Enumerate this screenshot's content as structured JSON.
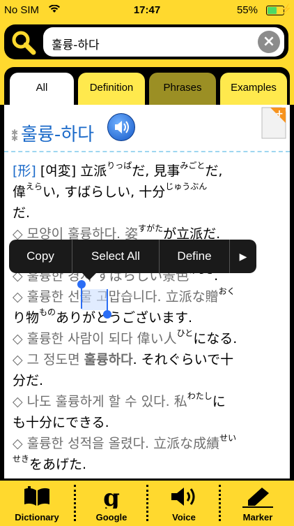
{
  "status": {
    "carrier": "No SIM",
    "time": "17:47",
    "battery_label": "55%",
    "battery_level": 0.55
  },
  "search": {
    "query": "훌륭-하다"
  },
  "tabs": [
    {
      "label": "All"
    },
    {
      "label": "Definition"
    },
    {
      "label": "Phrases"
    },
    {
      "label": "Examples"
    }
  ],
  "entry": {
    "headword": "훌륭-하다",
    "pos_tag": "[形]",
    "type_tag": "[여変]",
    "def1_a": "立派",
    "def1_ruby_a": "りっぱ",
    "def1_b": "だ, 見事",
    "def1_ruby_b": "みごと",
    "def1_c": "だ,",
    "def2_a": "偉",
    "def2_ruby_a": "えら",
    "def2_b": "い, すばらしい, 十分",
    "def2_ruby_b": "じゅうぶん",
    "def3": "だ.",
    "ex1_kr": "◇ 모양이 훌륭하다. 姿",
    "ex1_ruby": "すがた",
    "ex1_jp": "が立派だ.",
    "ex2_kr": "◇ 훌륭한 경치 すばらしい景色",
    "ex2_ruby": "けしき",
    "ex2_end": ".",
    "ex3_a": "◇ 훌륭한 ",
    "ex3_sel": "선물",
    "ex3_b": " 고맙습니다. 立派な贈",
    "ex3_ruby": "おく",
    "ex3_c": "り物",
    "ex3_ruby2": "もの",
    "ex3_d": "ありがとうございます.",
    "ex4_kr": "◇ 훌륭한 사람이 되다 偉い人",
    "ex4_ruby": "ひと",
    "ex4_jp": "になる.",
    "ex5_a": "◇ 그 정도면 ",
    "ex5_bold": "훌륭하다",
    "ex5_b": ". それぐらいで十",
    "ex5_c": "分だ.",
    "ex6_a": "◇ 나도 훌륭하게 할 수 있다. 私",
    "ex6_ruby": "わたし",
    "ex6_b": "に",
    "ex6_c": "も十分にできる.",
    "ex7_a": "◇ 훌륭한 성적을 올렸다. 立派な成績",
    "ex7_ruby": "せい",
    "ex7_ruby2": "せき",
    "ex7_b": "をあげた."
  },
  "context_menu": {
    "copy": "Copy",
    "select_all": "Select All",
    "define": "Define"
  },
  "toolbar": [
    {
      "label": "Dictionary",
      "icon": "book-icon"
    },
    {
      "label": "Google",
      "icon": "google-g-icon"
    },
    {
      "label": "Voice",
      "icon": "speaker-icon"
    },
    {
      "label": "Marker",
      "icon": "marker-icon"
    }
  ],
  "colors": {
    "accent_yellow": "#ffd92e",
    "olive_tab": "#9b8f24",
    "link_blue": "#1b6ac9",
    "selection": "#c9dcff"
  }
}
